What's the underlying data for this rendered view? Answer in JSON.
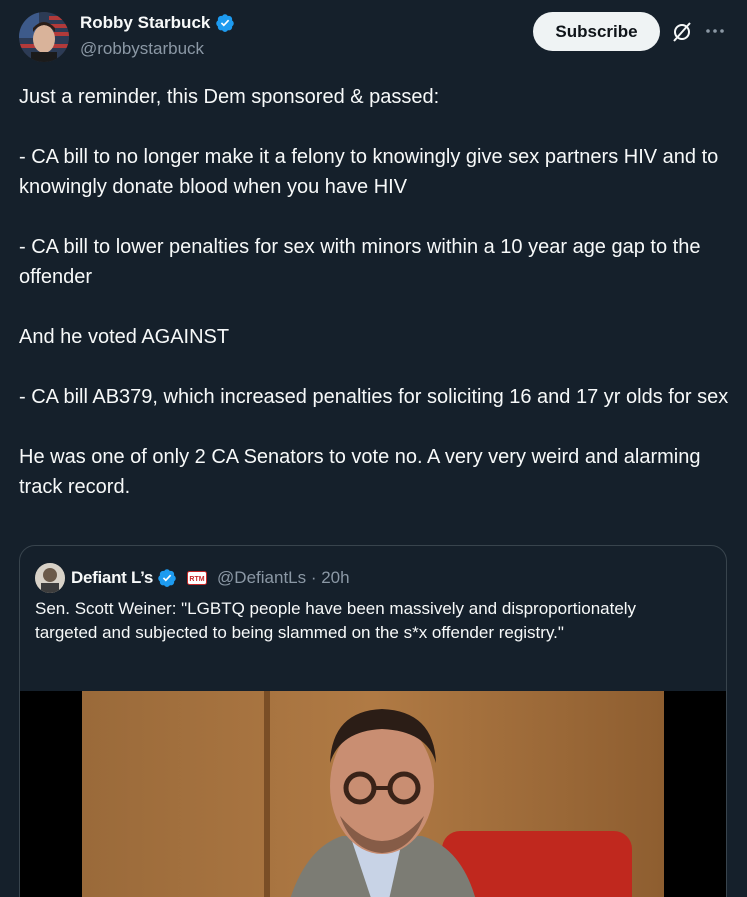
{
  "author": {
    "display_name": "Robby Starbuck",
    "handle": "@robbystarbuck"
  },
  "actions": {
    "subscribe_label": "Subscribe",
    "grok_icon": "grok-icon",
    "more_icon": "more-icon"
  },
  "tweet": {
    "paragraphs": [
      "Just a reminder, this Dem sponsored & passed:",
      "",
      "- CA bill to no longer make it a felony to knowingly give sex partners HIV and to knowingly donate blood when you have HIV",
      "",
      "- CA bill to lower penalties for sex with minors within a 10 year age gap to the offender",
      "",
      "And he voted AGAINST",
      "",
      "- CA bill AB379, which increased penalties for soliciting 16 and 17 yr olds for sex",
      "",
      "He was one of only 2 CA Senators to vote no. A very very weird and alarming track record."
    ]
  },
  "quoted_tweet": {
    "display_name": "Defiant L’s",
    "badge_text": "RTM",
    "handle_time": "@DefiantLs · 20h",
    "text": "Sen. Scott Weiner: \"LGBTQ people have been massively and disproportionately targeted and subjected to being slammed on the s*x offender registry.\""
  },
  "colors": {
    "background": "#15202b",
    "verified": "#1d9bf0",
    "border": "#38444d",
    "secondary_text": "#8b98a5"
  }
}
